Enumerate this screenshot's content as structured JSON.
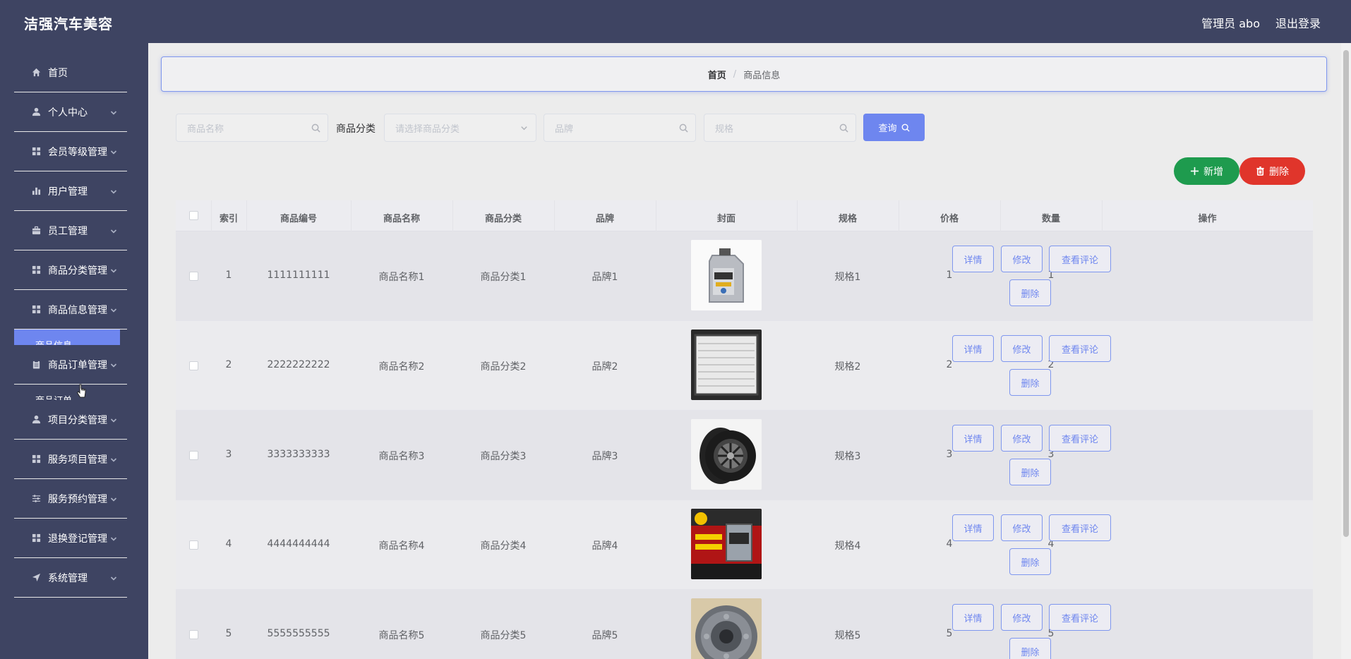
{
  "app": {
    "brand": "洁强汽车美容",
    "user": "管理员 abo",
    "logout": "退出登录"
  },
  "sidebar": {
    "items": [
      {
        "label": "首页",
        "icon": "home-icon"
      },
      {
        "label": "个人中心",
        "icon": "user-icon"
      },
      {
        "label": "会员等级管理",
        "icon": "grid-icon"
      },
      {
        "label": "用户管理",
        "icon": "bar-chart-icon"
      },
      {
        "label": "员工管理",
        "icon": "briefcase-icon"
      },
      {
        "label": "商品分类管理",
        "icon": "grid-icon"
      },
      {
        "label": "商品信息管理",
        "icon": "grid-icon"
      },
      {
        "label": "商品订单管理",
        "icon": "clipboard-icon"
      },
      {
        "label": "项目分类管理",
        "icon": "user-icon"
      },
      {
        "label": "服务项目管理",
        "icon": "grid-icon"
      },
      {
        "label": "服务预约管理",
        "icon": "sliders-icon"
      },
      {
        "label": "退换登记管理",
        "icon": "grid-icon"
      },
      {
        "label": "系统管理",
        "icon": "send-icon"
      }
    ],
    "sub_items": [
      "商品信息",
      "商品订单"
    ]
  },
  "breadcrumb": {
    "home": "首页",
    "separator": "/",
    "current": "商品信息"
  },
  "filters": {
    "name_placeholder": "商品名称",
    "category_label": "商品分类",
    "category_placeholder": "请选择商品分类",
    "brand_placeholder": "品牌",
    "spec_placeholder": "规格",
    "query": "查询"
  },
  "actions": {
    "add": "新增",
    "delete": "删除"
  },
  "table": {
    "headers": [
      "索引",
      "商品编号",
      "商品名称",
      "商品分类",
      "品牌",
      "封面",
      "规格",
      "价格",
      "数量",
      "操作"
    ],
    "row_buttons": {
      "detail": "详情",
      "edit": "修改",
      "comments": "查看评论",
      "delete": "删除"
    },
    "rows": [
      {
        "index": "1",
        "code": "1111111111",
        "name": "商品名称1",
        "category": "商品分类1",
        "brand": "品牌1",
        "cover": "motor-oil-bottle",
        "spec": "规格1",
        "price": "1",
        "qty": "1"
      },
      {
        "index": "2",
        "code": "2222222222",
        "name": "商品名称2",
        "category": "商品分类2",
        "brand": "品牌2",
        "cover": "air-filter",
        "spec": "规格2",
        "price": "2",
        "qty": "2"
      },
      {
        "index": "3",
        "code": "3333333333",
        "name": "商品名称3",
        "category": "商品分类3",
        "brand": "品牌3",
        "cover": "tire",
        "spec": "规格3",
        "price": "3",
        "qty": "3"
      },
      {
        "index": "4",
        "code": "4444444444",
        "name": "商品名称4",
        "category": "商品分类4",
        "brand": "品牌4",
        "cover": "oil-ad",
        "spec": "规格4",
        "price": "4",
        "qty": "4"
      },
      {
        "index": "5",
        "code": "5555555555",
        "name": "商品名称5",
        "category": "商品分类5",
        "brand": "品牌5",
        "cover": "clutch-disc",
        "spec": "规格5",
        "price": "5",
        "qty": "5"
      }
    ]
  }
}
